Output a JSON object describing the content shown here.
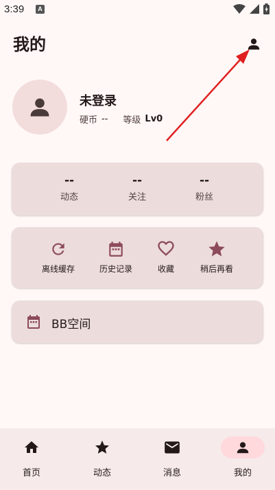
{
  "status_bar": {
    "time": "3:39",
    "notification_letter": "A"
  },
  "header": {
    "title": "我的",
    "account_icon": "person-icon"
  },
  "profile": {
    "avatar_icon": "person-icon",
    "name": "未登录",
    "coin_label": "硬币",
    "coin_value": "--",
    "level_label": "等级",
    "level_value": "Lv0"
  },
  "stats": [
    {
      "count": "--",
      "label": "动态"
    },
    {
      "count": "--",
      "label": "关注"
    },
    {
      "count": "--",
      "label": "粉丝"
    }
  ],
  "quick_actions": [
    {
      "label": "离线缓存",
      "icon": "refresh-icon"
    },
    {
      "label": "历史记录",
      "icon": "calendar-icon"
    },
    {
      "label": "收藏",
      "icon": "heart-icon"
    },
    {
      "label": "稍后再看",
      "icon": "star-icon"
    }
  ],
  "bb_space": {
    "label": "BB空间",
    "icon": "calendar-icon"
  },
  "bottom_nav": [
    {
      "label": "首页",
      "icon": "home-icon",
      "active": false
    },
    {
      "label": "动态",
      "icon": "star-icon",
      "active": false
    },
    {
      "label": "消息",
      "icon": "mail-icon",
      "active": false
    },
    {
      "label": "我的",
      "icon": "person-icon",
      "active": true
    }
  ],
  "colors": {
    "background": "#fff8f7",
    "card": "#ecdcdc",
    "accent": "#8c4a5a",
    "arrow": "#e02020"
  }
}
